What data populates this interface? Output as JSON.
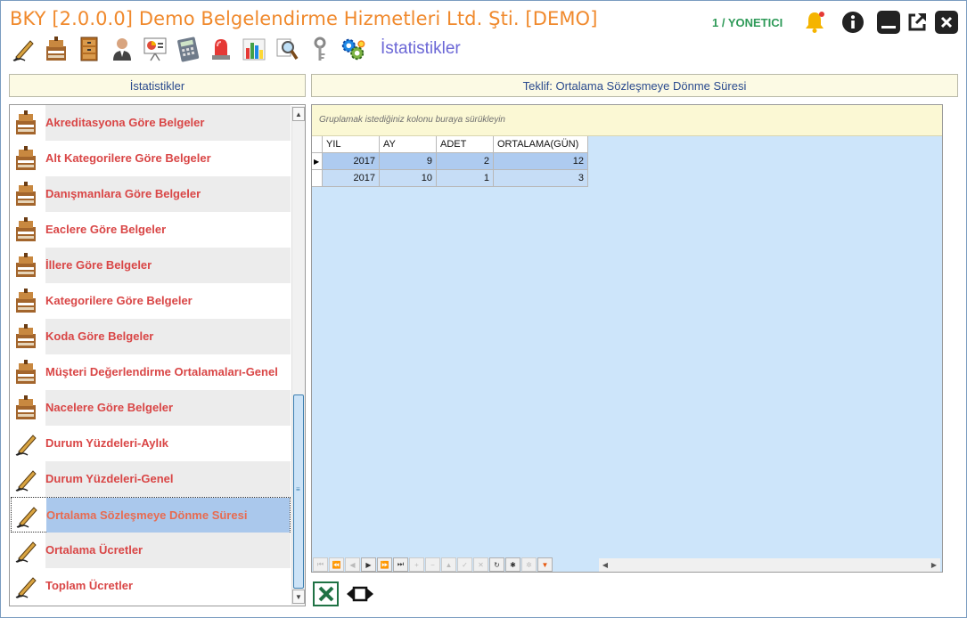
{
  "window": {
    "title": "BKY [2.0.0.0] Demo Belgelendirme Hizmetleri Ltd. Şti. [DEMO]",
    "user": "1 / YONETICI"
  },
  "header_icons": [
    "bell-icon",
    "info-icon",
    "minimize-icon",
    "popout-icon",
    "close-icon"
  ],
  "toolbar": {
    "icons": [
      "pen-icon",
      "building-icon",
      "cabinet-icon",
      "user-icon",
      "presentation-icon",
      "calculator-icon",
      "alarm-light-icon",
      "bar-chart-icon",
      "magnifier-icon",
      "key-icon",
      "gears-icon"
    ],
    "page_heading": "İstatistikler"
  },
  "left_panel": {
    "header": "İstatistikler",
    "items": [
      {
        "label": "Akreditasyona Göre Belgeler",
        "icon": "building-icon"
      },
      {
        "label": "Alt Kategorilere Göre Belgeler",
        "icon": "building-icon"
      },
      {
        "label": "Danışmanlara Göre Belgeler",
        "icon": "building-icon"
      },
      {
        "label": "Eaclere Göre Belgeler",
        "icon": "building-icon"
      },
      {
        "label": "İllere Göre Belgeler",
        "icon": "building-icon"
      },
      {
        "label": "Kategorilere Göre Belgeler",
        "icon": "building-icon"
      },
      {
        "label": "Koda Göre Belgeler",
        "icon": "building-icon"
      },
      {
        "label": "Müşteri Değerlendirme Ortalamaları-Genel",
        "icon": "building-icon"
      },
      {
        "label": "Nacelere Göre Belgeler",
        "icon": "building-icon"
      },
      {
        "label": "Durum Yüzdeleri-Aylık",
        "icon": "pen-icon"
      },
      {
        "label": "Durum Yüzdeleri-Genel",
        "icon": "pen-icon"
      },
      {
        "label": "Ortalama Sözleşmeye Dönme Süresi",
        "icon": "pen-icon"
      },
      {
        "label": "Ortalama Ücretler",
        "icon": "pen-icon"
      },
      {
        "label": "Toplam Ücretler",
        "icon": "pen-icon"
      }
    ],
    "selected_index": 11
  },
  "right_panel": {
    "header": "Teklif: Ortalama Sözleşmeye Dönme Süresi",
    "group_hint": "Gruplamak istediğiniz kolonu buraya sürükleyin",
    "columns": [
      "YIL",
      "AY",
      "ADET",
      "ORTALAMA(GÜN)"
    ],
    "rows": [
      [
        "2017",
        "9",
        "2",
        "12"
      ],
      [
        "2017",
        "10",
        "1",
        "3"
      ]
    ],
    "selected_row": 0
  },
  "bottom": {
    "icons": [
      "excel-export-icon",
      "fit-columns-icon"
    ]
  },
  "colors": {
    "title": "#f0892c",
    "user": "#2e9a58",
    "heading": "#6b67d6",
    "list_text": "#d94646",
    "selected_bg": "#aac8ec",
    "grid_bg": "#cde5fa",
    "group_panel_bg": "#fbf8d4"
  }
}
